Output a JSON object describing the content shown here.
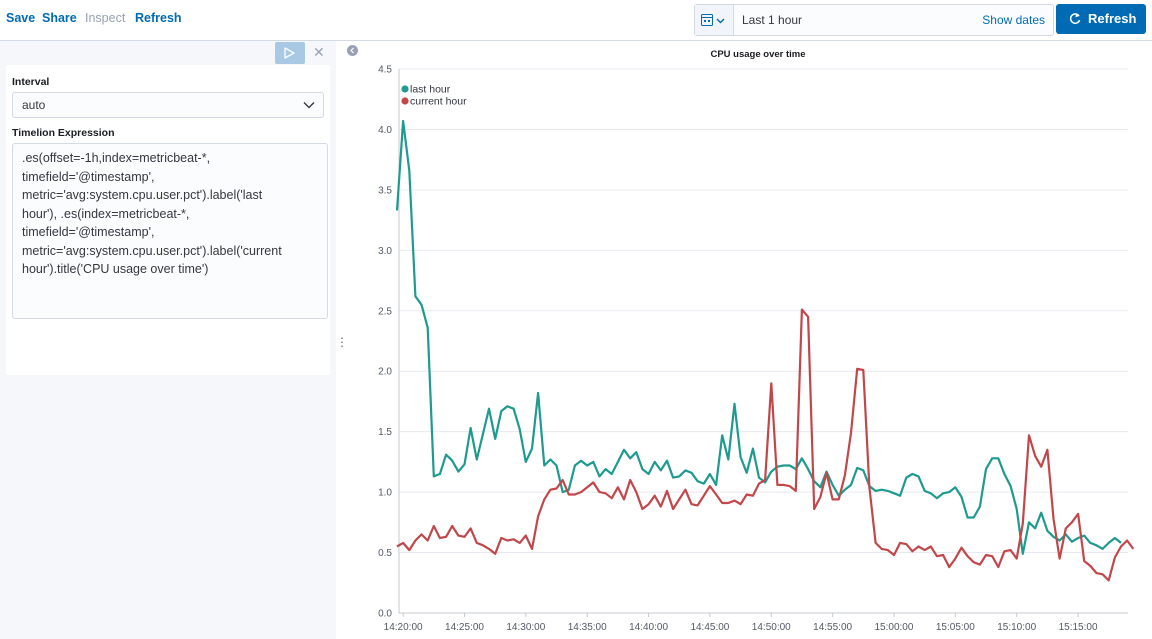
{
  "toolbar": {
    "save_label": "Save",
    "share_label": "Share",
    "inspect_label": "Inspect",
    "refresh_link_label": "Refresh"
  },
  "datepicker": {
    "icon": "calendar-icon",
    "range_label": "Last 1 hour",
    "show_dates_label": "Show dates"
  },
  "refresh_button": {
    "label": "Refresh",
    "icon": "refresh-icon"
  },
  "editor": {
    "interval_label": "Interval",
    "interval_value": "auto",
    "expression_label": "Timelion Expression",
    "expression": ".es(offset=-1h,index=metricbeat-*,\ntimefield='@timestamp',\nmetric='avg:system.cpu.user.pct').label('last\nhour'), .es(index=metricbeat-*,\ntimefield='@timestamp',\nmetric='avg:system.cpu.user.pct').label('current\nhour').title('CPU usage over time')"
  },
  "colors": {
    "accent": "#006bb4",
    "last_hour": "#1e9a8f",
    "current_hour": "#c1474a"
  },
  "chart_data": {
    "type": "line",
    "title": "CPU usage over time",
    "legend_position": "top-left",
    "grid": true,
    "ylim": [
      0,
      4.5
    ],
    "y_ticks": [
      "0.0",
      "0.5",
      "1.0",
      "1.5",
      "2.0",
      "2.5",
      "3.0",
      "3.5",
      "4.0",
      "4.5"
    ],
    "x_ticks": [
      "14:20:00",
      "14:25:00",
      "14:30:00",
      "14:35:00",
      "14:40:00",
      "14:45:00",
      "14:50:00",
      "14:55:00",
      "15:00:00",
      "15:05:00",
      "15:10:00",
      "15:15:00"
    ],
    "x_start": "14:19:30",
    "x_step_seconds": 30,
    "series": [
      {
        "name": "last hour",
        "color": "#1e9a8f",
        "values": [
          3.33,
          4.07,
          3.66,
          2.62,
          2.55,
          2.36,
          1.13,
          1.15,
          1.31,
          1.26,
          1.17,
          1.23,
          1.53,
          1.27,
          1.48,
          1.69,
          1.44,
          1.67,
          1.71,
          1.69,
          1.52,
          1.25,
          1.36,
          1.82,
          1.22,
          1.27,
          1.22,
          1.0,
          1.02,
          1.22,
          1.26,
          1.22,
          1.25,
          1.13,
          1.19,
          1.15,
          1.25,
          1.35,
          1.28,
          1.33,
          1.19,
          1.15,
          1.25,
          1.18,
          1.26,
          1.12,
          1.13,
          1.18,
          1.16,
          1.09,
          1.07,
          1.15,
          1.06,
          1.47,
          1.27,
          1.73,
          1.29,
          1.16,
          1.36,
          1.12,
          1.08,
          1.17,
          1.21,
          1.22,
          1.22,
          1.19,
          1.28,
          1.19,
          1.09,
          1.04,
          1.17,
          1.06,
          0.97,
          1.02,
          1.06,
          1.2,
          1.18,
          1.05,
          1.01,
          1.02,
          1.01,
          0.99,
          0.97,
          1.12,
          1.15,
          1.13,
          1.01,
          0.99,
          0.95,
          0.99,
          1.0,
          1.04,
          0.96,
          0.79,
          0.79,
          0.88,
          1.19,
          1.28,
          1.28,
          1.15,
          1.05,
          0.86,
          0.49,
          0.75,
          0.7,
          0.83,
          0.68,
          0.63,
          0.6,
          0.65,
          0.59,
          0.62,
          0.64,
          0.58,
          0.56,
          0.53,
          0.58,
          0.62,
          0.58
        ]
      },
      {
        "name": "current hour",
        "color": "#c1474a",
        "values": [
          0.55,
          0.58,
          0.52,
          0.6,
          0.65,
          0.6,
          0.72,
          0.62,
          0.63,
          0.72,
          0.64,
          0.63,
          0.7,
          0.58,
          0.56,
          0.53,
          0.49,
          0.62,
          0.6,
          0.61,
          0.58,
          0.64,
          0.53,
          0.8,
          0.94,
          1.02,
          1.03,
          1.1,
          0.98,
          0.98,
          1.0,
          1.04,
          1.08,
          1.0,
          0.99,
          0.95,
          1.04,
          0.94,
          1.1,
          1.0,
          0.86,
          0.9,
          0.97,
          0.88,
          1.01,
          0.86,
          0.94,
          1.02,
          0.9,
          0.89,
          0.97,
          1.05,
          0.98,
          0.91,
          0.91,
          0.93,
          0.9,
          0.98,
          0.97,
          1.07,
          1.1,
          1.9,
          1.06,
          1.06,
          1.05,
          1.01,
          2.51,
          2.45,
          0.86,
          0.96,
          1.16,
          0.94,
          0.94,
          1.14,
          1.49,
          2.02,
          2.01,
          1.04,
          0.58,
          0.53,
          0.52,
          0.48,
          0.58,
          0.57,
          0.51,
          0.55,
          0.52,
          0.55,
          0.47,
          0.48,
          0.38,
          0.45,
          0.54,
          0.47,
          0.42,
          0.4,
          0.48,
          0.47,
          0.38,
          0.51,
          0.52,
          0.45,
          0.74,
          1.47,
          1.3,
          1.21,
          1.35,
          0.78,
          0.45,
          0.7,
          0.75,
          0.82,
          0.43,
          0.39,
          0.33,
          0.32,
          0.27,
          0.46,
          0.55,
          0.6,
          0.53
        ]
      }
    ]
  }
}
